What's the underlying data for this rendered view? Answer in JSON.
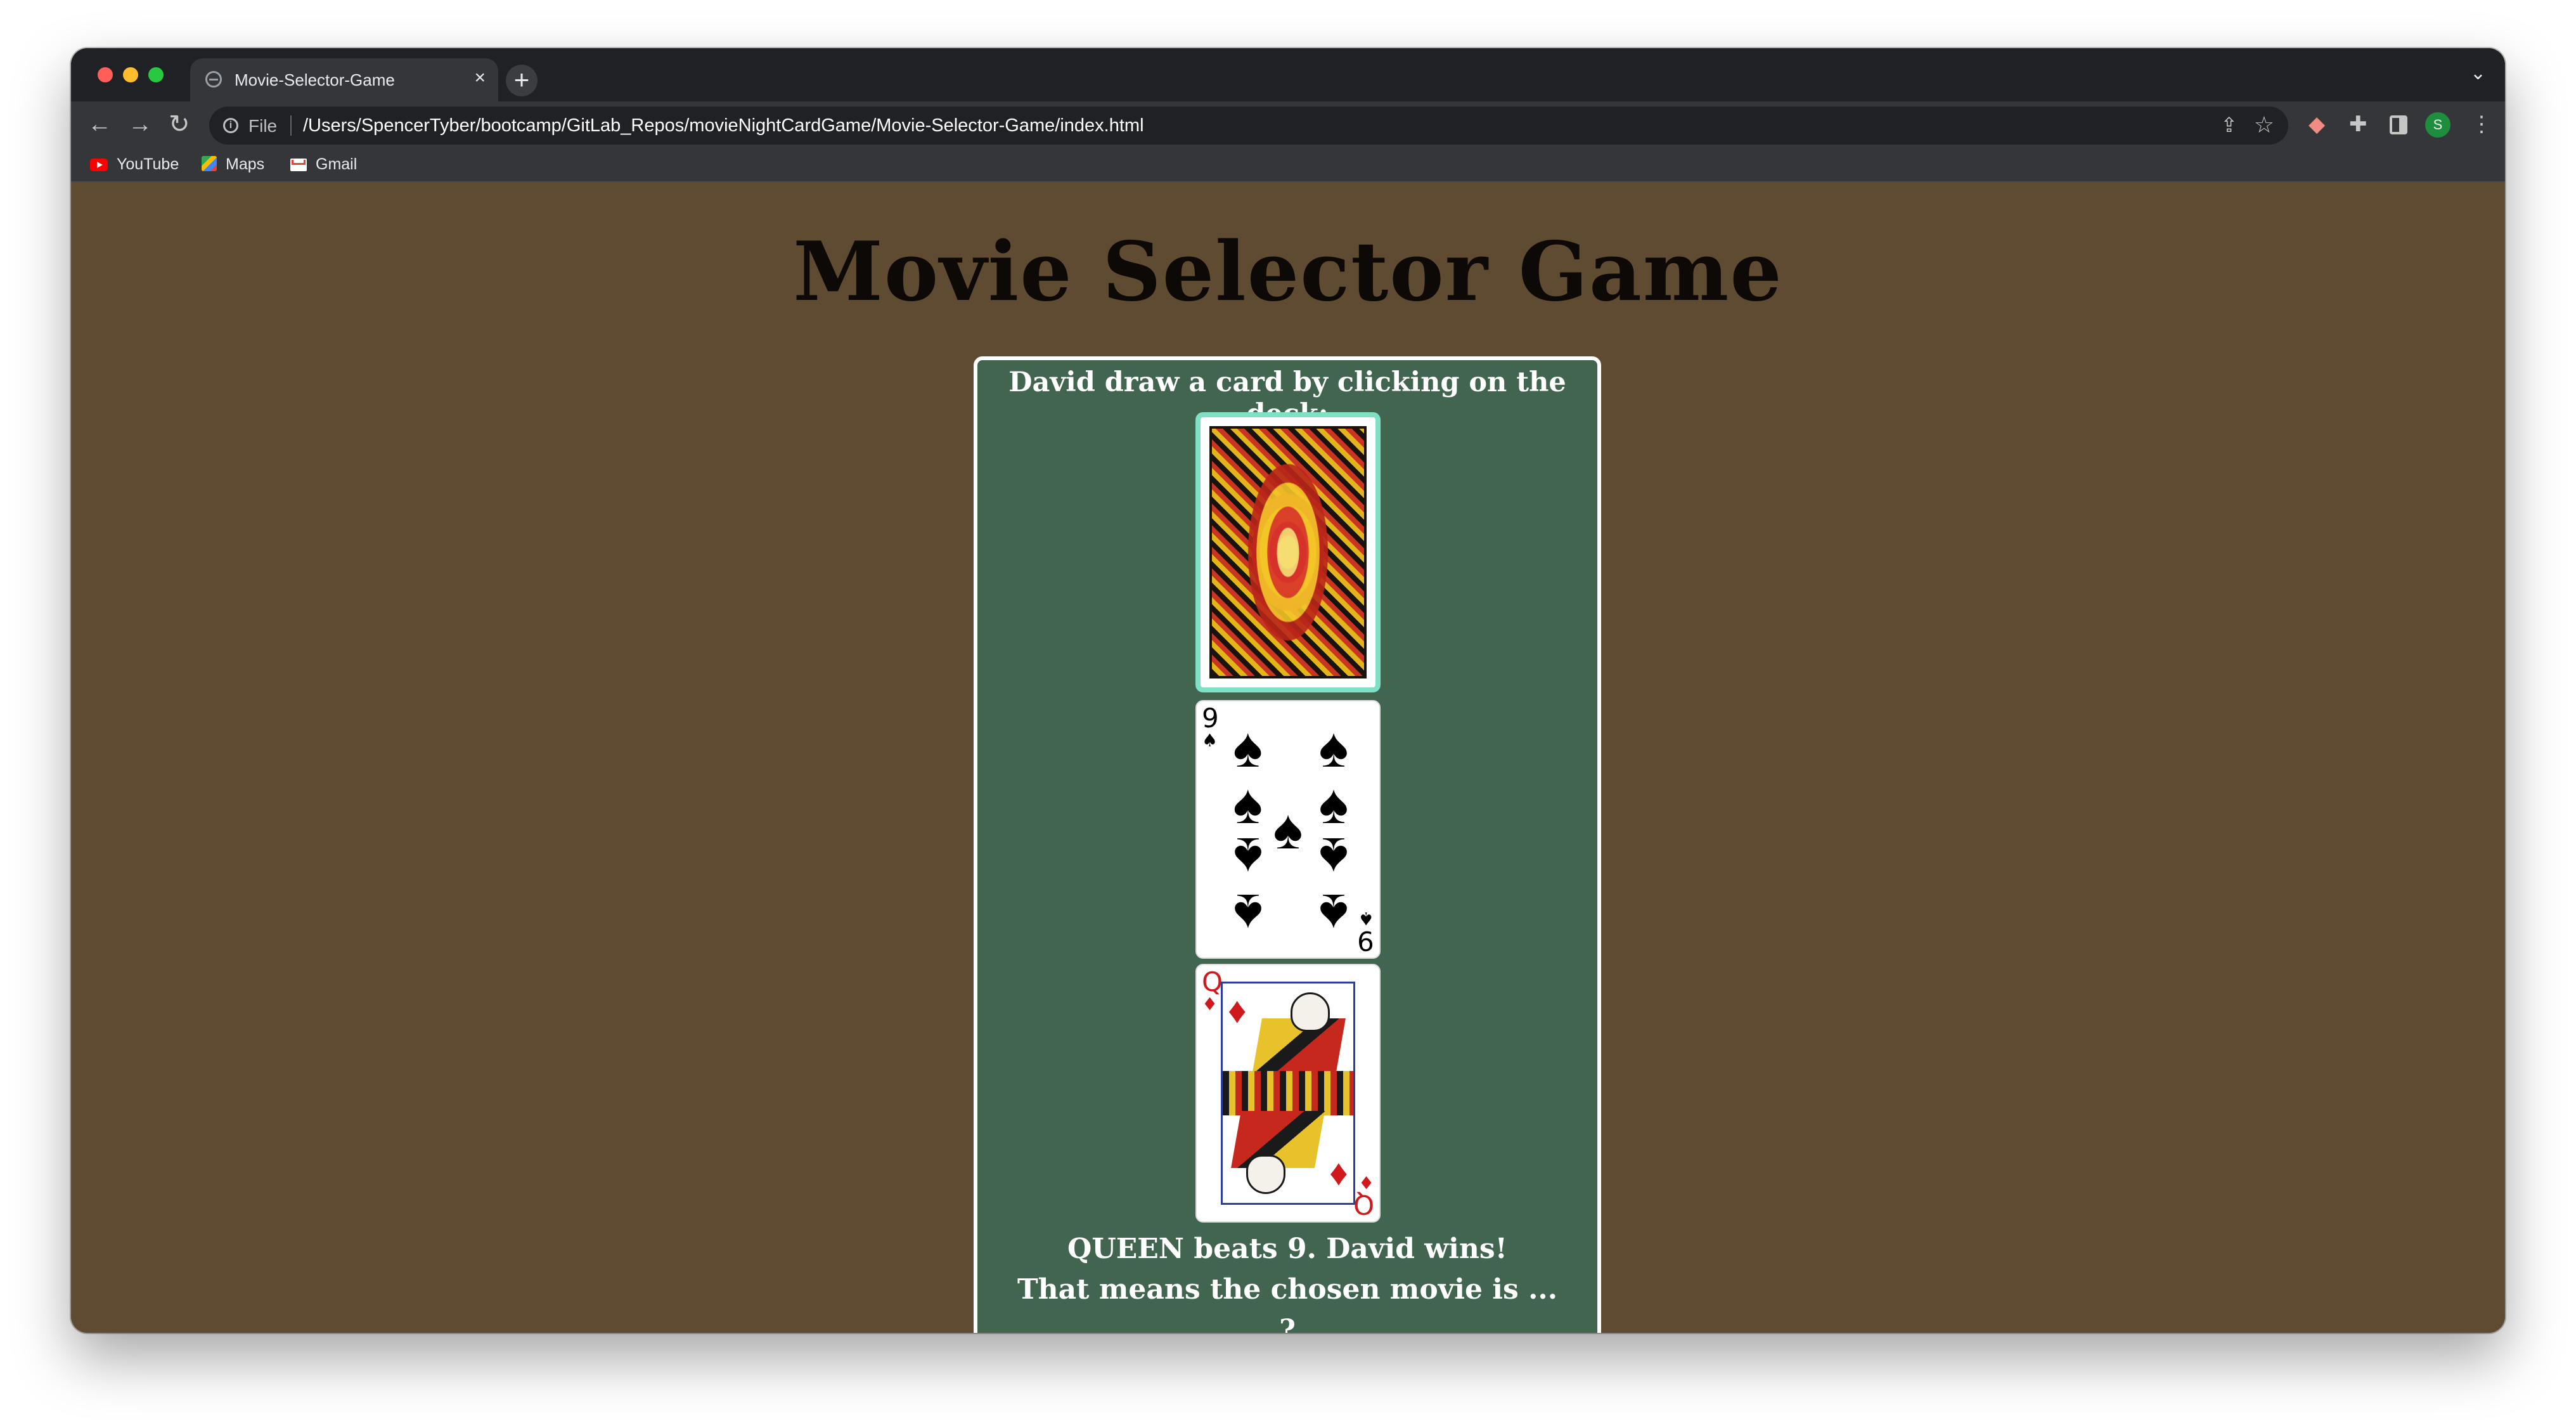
{
  "browser": {
    "tab_title": "Movie-Selector-Game",
    "tab_close": "×",
    "new_tab": "+",
    "tab_menu": "⌄",
    "file_label": "File",
    "url": "/Users/SpencerTyber/bootcamp/GitLab_Repos/movieNightCardGame/Movie-Selector-Game/index.html",
    "avatar_letter": "S",
    "bookmarks": [
      {
        "label": "YouTube",
        "icon": "youtube-icon"
      },
      {
        "label": "Maps",
        "icon": "maps-icon"
      },
      {
        "label": "Gmail",
        "icon": "gmail-icon"
      }
    ]
  },
  "page": {
    "title": "Movie Selector Game",
    "prompt": "David draw a card by clicking on the deck:",
    "drawn_cards": [
      {
        "rank": "9",
        "suit": "spades",
        "suit_symbol": "♠",
        "color": "#000000"
      },
      {
        "rank": "Q",
        "suit": "diamonds",
        "suit_symbol": "♦",
        "color": "#d0191d"
      }
    ],
    "result_line1": "QUEEN beats 9. David wins!",
    "result_line2": "That means the chosen movie is ...",
    "result_line3": "?"
  },
  "colors": {
    "page_background": "#5f4b31",
    "panel_background": "#426550",
    "deck_highlight": "#7fe0c4"
  }
}
